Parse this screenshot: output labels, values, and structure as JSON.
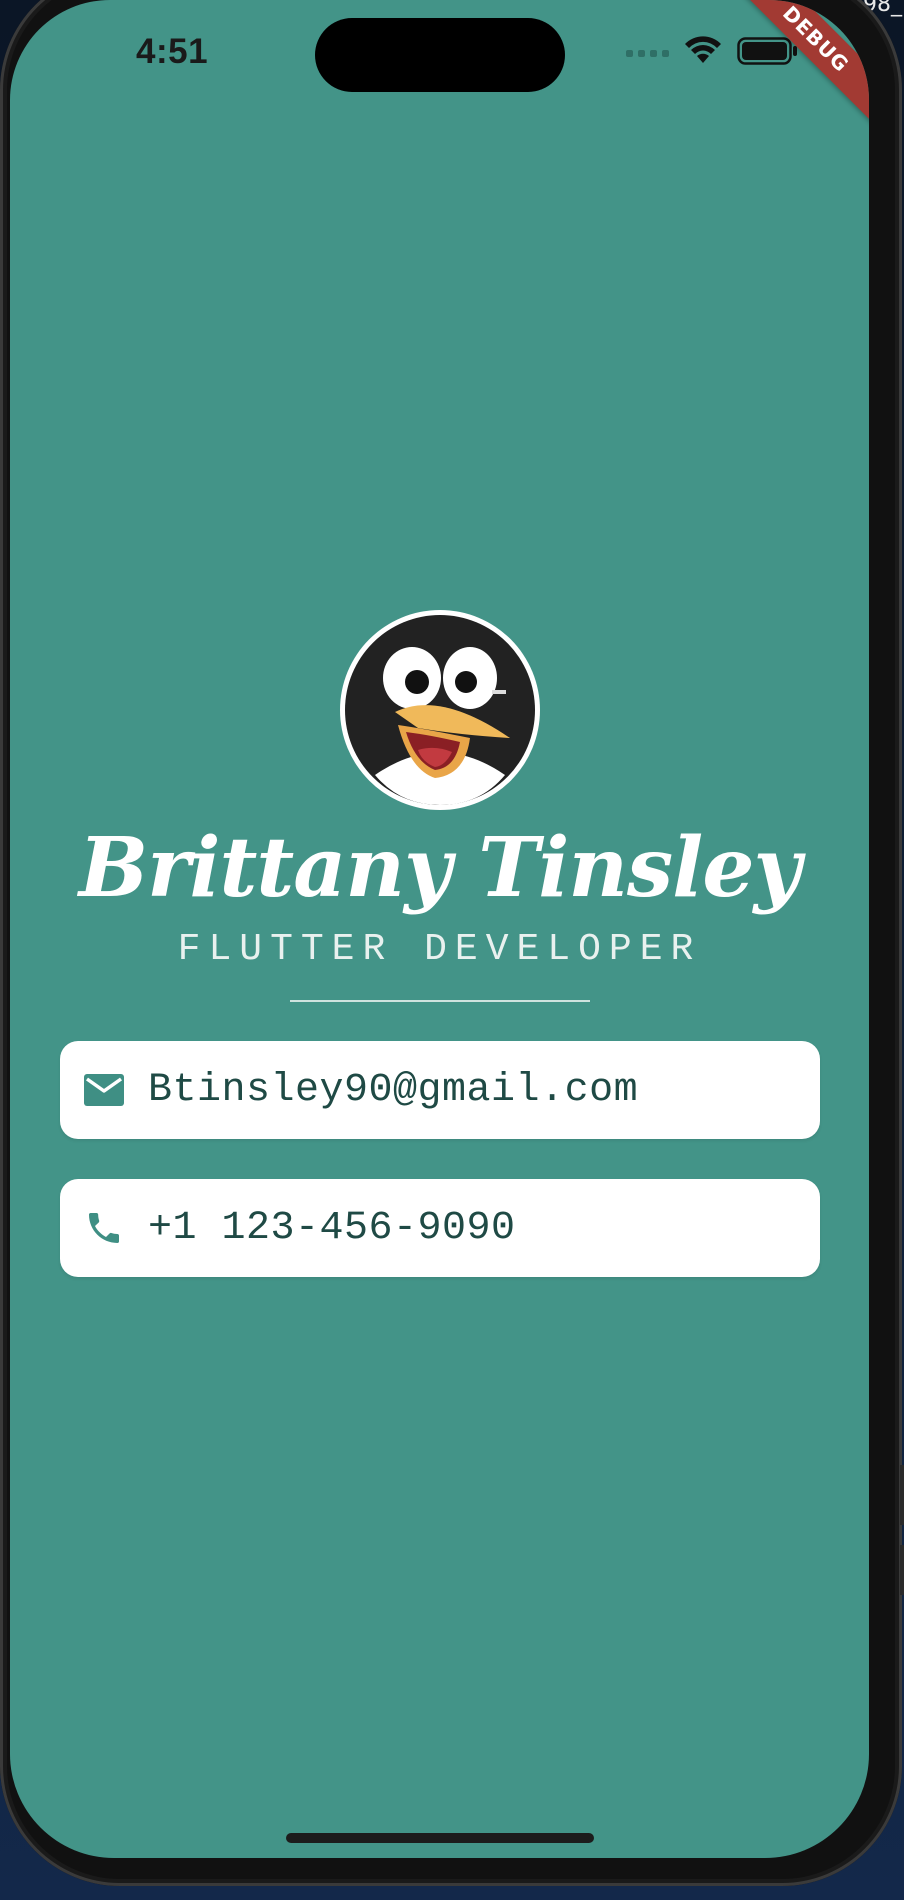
{
  "status_bar": {
    "time": "4:51"
  },
  "corner_text": "98_",
  "debug_banner": "DEBUG",
  "profile": {
    "name": "Brittany Tinsley",
    "title": "FLUTTER DEVELOPER"
  },
  "contacts": {
    "email": "Btinsley90@gmail.com",
    "phone": "+1 123-456-9090"
  },
  "colors": {
    "background": "#439488",
    "card": "#ffffff",
    "icon": "#3f8f84",
    "text_dark": "#1f4a45",
    "debug": "#a23a33"
  },
  "icons": {
    "email": "mail-icon",
    "phone": "phone-icon",
    "wifi": "wifi-icon",
    "battery": "battery-icon",
    "signal": "cellular-signal-icon"
  }
}
